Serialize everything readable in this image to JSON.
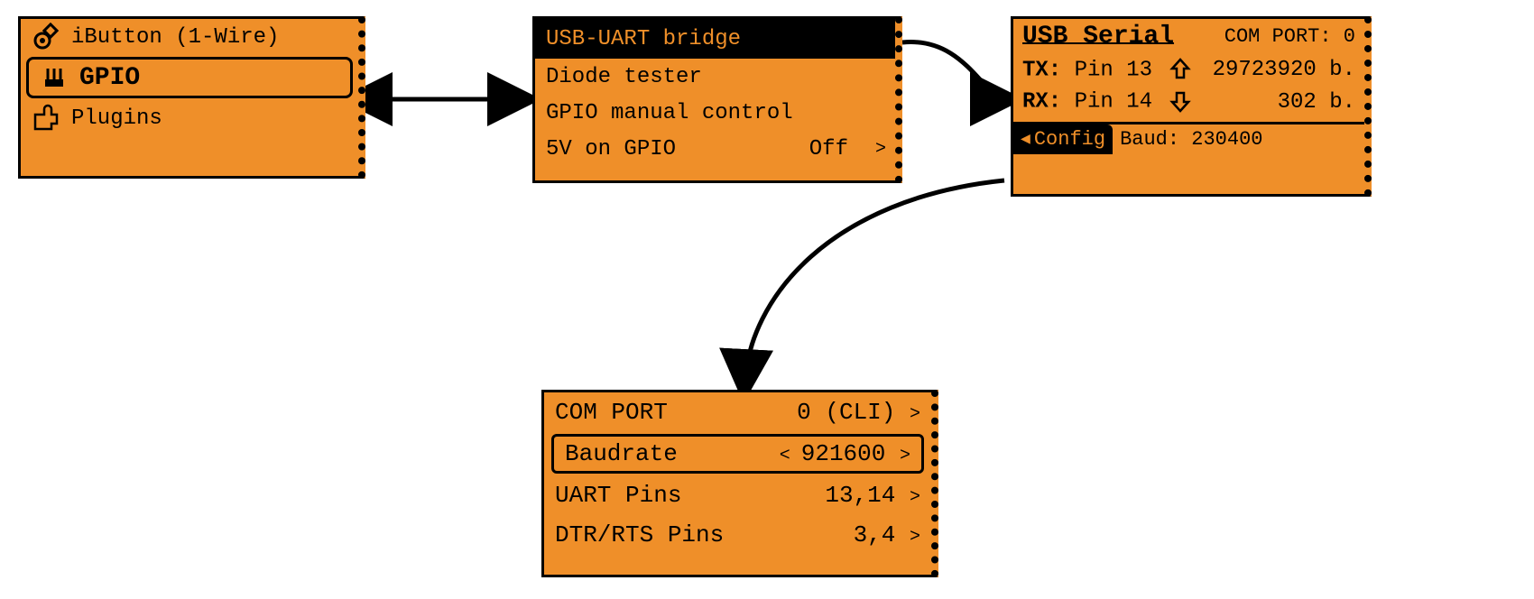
{
  "screens": {
    "main_menu": {
      "items": {
        "ibutton": "iButton (1-Wire)",
        "gpio": "GPIO",
        "plugins": "Plugins"
      }
    },
    "gpio_menu": {
      "items": {
        "usb_uart": "USB-UART bridge",
        "diode": "Diode tester",
        "manual": "GPIO manual control",
        "fiveV_label": "5V on GPIO",
        "fiveV_value": "Off"
      }
    },
    "usb_serial": {
      "title": "USB Serial",
      "com_port_label": "COM PORT: 0",
      "tx_label": "TX:",
      "tx_pin": "Pin 13",
      "tx_bytes": "29723920 b.",
      "rx_label": "RX:",
      "rx_pin": "Pin 14",
      "rx_bytes": "302 b.",
      "config_label": "Config",
      "baud_label": "Baud: 230400"
    },
    "config": {
      "com_port_label": "COM PORT",
      "com_port_value": "0 (CLI)",
      "baud_label": "Baudrate",
      "baud_value": "921600",
      "uart_label": "UART Pins",
      "uart_value": "13,14",
      "dtr_label": "DTR/RTS Pins",
      "dtr_value": "3,4"
    }
  }
}
